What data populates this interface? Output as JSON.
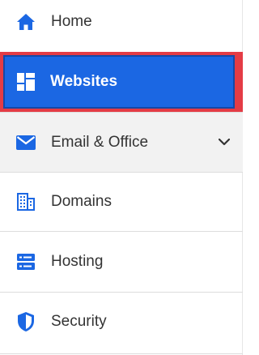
{
  "nav": {
    "items": [
      {
        "id": "home",
        "label": "Home",
        "icon": "home-icon"
      },
      {
        "id": "websites",
        "label": "Websites",
        "icon": "websites-grid-icon",
        "selected": true
      },
      {
        "id": "email",
        "label": "Email & Office",
        "icon": "mail-icon",
        "expandable": true
      },
      {
        "id": "domains",
        "label": "Domains",
        "icon": "domains-building-icon"
      },
      {
        "id": "hosting",
        "label": "Hosting",
        "icon": "server-icon"
      },
      {
        "id": "security",
        "label": "Security",
        "icon": "shield-icon"
      }
    ]
  },
  "colors": {
    "accent": "#1b67e3",
    "highlight_outline": "#e43c45",
    "text": "#333333",
    "expanded_bg": "#f2f2f2"
  }
}
